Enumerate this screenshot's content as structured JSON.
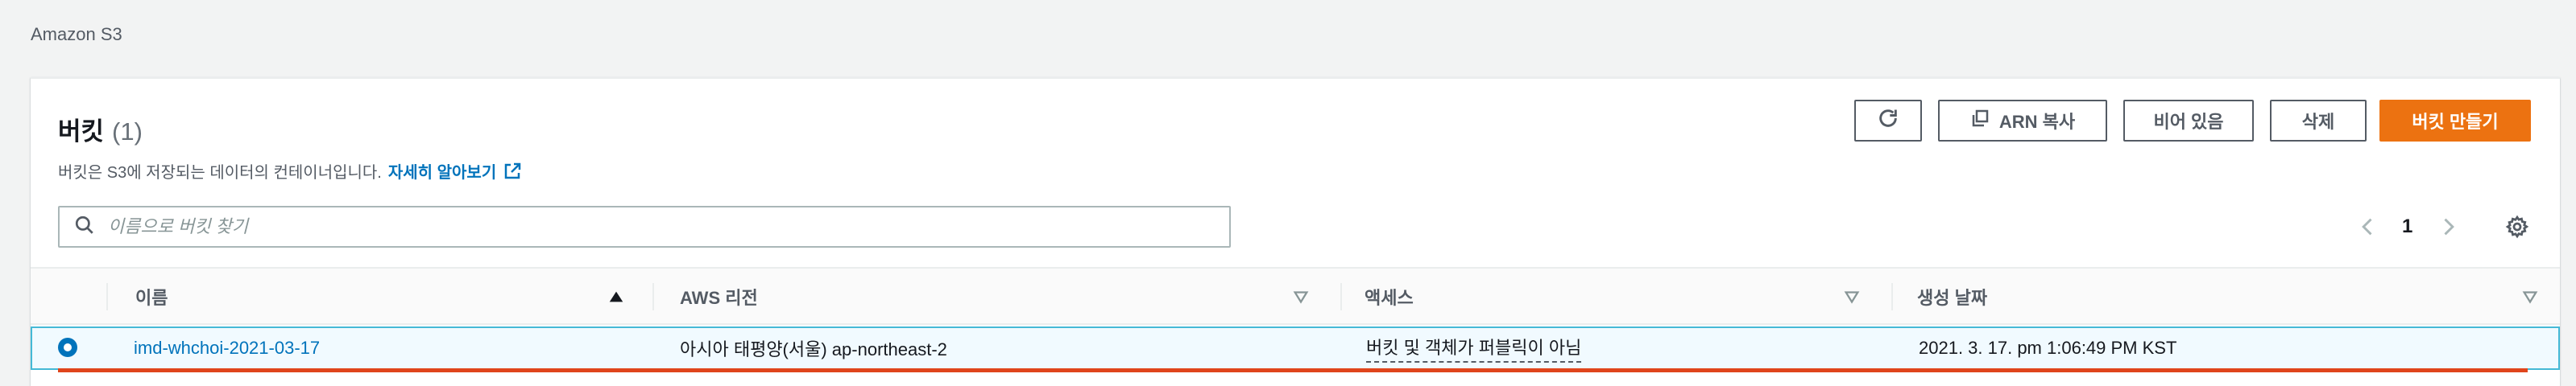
{
  "breadcrumb": "Amazon S3",
  "panel": {
    "title": "버킷",
    "count": "(1)",
    "description": "버킷은 S3에 저장되는 데이터의 컨테이너입니다.",
    "learn_more": "자세히 알아보기",
    "external_icon": "external-link-icon"
  },
  "toolbar": {
    "refresh_icon": "refresh-icon",
    "copy_arn_label": "ARN 복사",
    "copy_arn_icon": "copy-icon",
    "empty_label": "비어 있음",
    "delete_label": "삭제",
    "create_label": "버킷 만들기"
  },
  "search": {
    "placeholder": "이름으로 버킷 찾기",
    "value": "",
    "icon": "search-icon"
  },
  "pagination": {
    "current_page": "1",
    "prev_icon": "chevron-left-icon",
    "next_icon": "chevron-right-icon",
    "settings_icon": "gear-icon"
  },
  "table": {
    "columns": [
      "이름",
      "AWS 리전",
      "액세스",
      "생성 날짜"
    ],
    "rows": [
      {
        "selected": true,
        "name": "imd-whchoi-2021-03-17",
        "region": "아시아 태평양(서울) ap-northeast-2",
        "access": "버킷 및 객체가 퍼블릭이 아님",
        "created": "2021. 3. 17. pm 1:06:49 PM KST"
      }
    ]
  },
  "colors": {
    "accent": "#0073bb",
    "primary_button": "#ec7211",
    "selection_border": "#44b9d6",
    "selection_bg": "#f1faff",
    "highlight_underline": "#e0451c"
  }
}
